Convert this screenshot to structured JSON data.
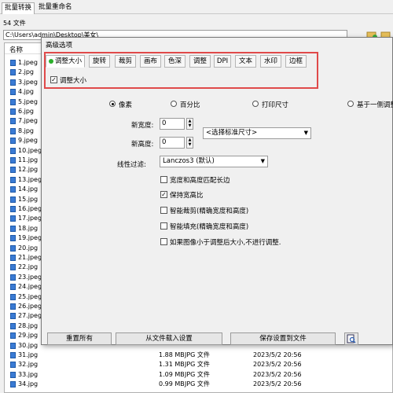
{
  "top_tabs": [
    "批量转换",
    "批量重命名"
  ],
  "file_count": "54 文件",
  "path_value": "C:\\Users\\admin\\Desktop\\美女\\",
  "column_name": "名称",
  "files": [
    {
      "name": "1.jpeg",
      "size": "",
      "type": "",
      "date": ""
    },
    {
      "name": "2.jpg",
      "size": "",
      "type": "",
      "date": ""
    },
    {
      "name": "3.jpeg",
      "size": "",
      "type": "",
      "date": ""
    },
    {
      "name": "4.jpg",
      "size": "",
      "type": "",
      "date": ""
    },
    {
      "name": "5.jpeg",
      "size": "",
      "type": "",
      "date": ""
    },
    {
      "name": "6.jpg",
      "size": "",
      "type": "",
      "date": ""
    },
    {
      "name": "7.jpeg",
      "size": "",
      "type": "",
      "date": ""
    },
    {
      "name": "8.jpg",
      "size": "",
      "type": "",
      "date": ""
    },
    {
      "name": "9.jpeg",
      "size": "",
      "type": "",
      "date": ""
    },
    {
      "name": "10.jpeg",
      "size": "",
      "type": "",
      "date": ""
    },
    {
      "name": "11.jpg",
      "size": "",
      "type": "",
      "date": ""
    },
    {
      "name": "12.jpg",
      "size": "",
      "type": "",
      "date": ""
    },
    {
      "name": "13.jpeg",
      "size": "",
      "type": "",
      "date": ""
    },
    {
      "name": "14.jpg",
      "size": "",
      "type": "",
      "date": ""
    },
    {
      "name": "15.jpg",
      "size": "",
      "type": "",
      "date": ""
    },
    {
      "name": "16.jpeg",
      "size": "",
      "type": "",
      "date": ""
    },
    {
      "name": "17.jpeg",
      "size": "",
      "type": "",
      "date": ""
    },
    {
      "name": "18.jpg",
      "size": "",
      "type": "",
      "date": ""
    },
    {
      "name": "19.jpeg",
      "size": "",
      "type": "",
      "date": ""
    },
    {
      "name": "20.jpg",
      "size": "",
      "type": "",
      "date": ""
    },
    {
      "name": "21.jpeg",
      "size": "",
      "type": "",
      "date": ""
    },
    {
      "name": "22.jpg",
      "size": "",
      "type": "",
      "date": ""
    },
    {
      "name": "23.jpeg",
      "size": "",
      "type": "",
      "date": ""
    },
    {
      "name": "24.jpeg",
      "size": "",
      "type": "",
      "date": ""
    },
    {
      "name": "25.jpeg",
      "size": "",
      "type": "",
      "date": ""
    },
    {
      "name": "26.jpeg",
      "size": "",
      "type": "",
      "date": ""
    },
    {
      "name": "27.jpeg",
      "size": "",
      "type": "",
      "date": ""
    },
    {
      "name": "28.jpg",
      "size": "",
      "type": "",
      "date": ""
    },
    {
      "name": "29.jpg",
      "size": "",
      "type": "",
      "date": ""
    },
    {
      "name": "30.jpg",
      "size": "",
      "type": "",
      "date": ""
    },
    {
      "name": "31.jpg",
      "size": "1.88 MB",
      "type": "JPG 文件",
      "date": "2023/5/2 20:56"
    },
    {
      "name": "32.jpg",
      "size": "1.31 MB",
      "type": "JPG 文件",
      "date": "2023/5/2 20:56"
    },
    {
      "name": "33.jpg",
      "size": "1.09 MB",
      "type": "JPG 文件",
      "date": "2023/5/2 20:56"
    },
    {
      "name": "34.jpg",
      "size": "0.99 MB",
      "type": "JPG 文件",
      "date": "2023/5/2 20:56"
    }
  ],
  "dialog": {
    "title": "高级选项",
    "tabs": [
      "调整大小",
      "旋转",
      "裁剪",
      "画布",
      "色深",
      "调整",
      "DPI",
      "文本",
      "水印",
      "边框"
    ],
    "resize_checkbox": "调整大小",
    "radios": [
      "像素",
      "百分比",
      "打印尺寸",
      "基于一侧调整"
    ],
    "new_width_label": "新宽度:",
    "new_width_value": "0",
    "new_height_label": "新高度:",
    "new_height_value": "0",
    "standard_size_placeholder": "<选择标准尺寸>",
    "filter_label": "线性过滤:",
    "filter_value": "Lanczos3 (默认)",
    "options": [
      {
        "label": "宽度和高度匹配长边",
        "checked": false
      },
      {
        "label": "保持宽高比",
        "checked": true
      },
      {
        "label": "智能裁剪(精确宽度和高度)",
        "checked": false
      },
      {
        "label": "智能填充(精确宽度和高度)",
        "checked": false
      },
      {
        "label": "如果图像小于调整后大小,不进行调整.",
        "checked": false
      }
    ],
    "buttons": {
      "reset": "重置所有",
      "load": "从文件载入设置",
      "save": "保存设置到文件"
    }
  },
  "colors": {
    "highlight_border": "#e04a4a",
    "active_dot": "#2bb02b"
  }
}
